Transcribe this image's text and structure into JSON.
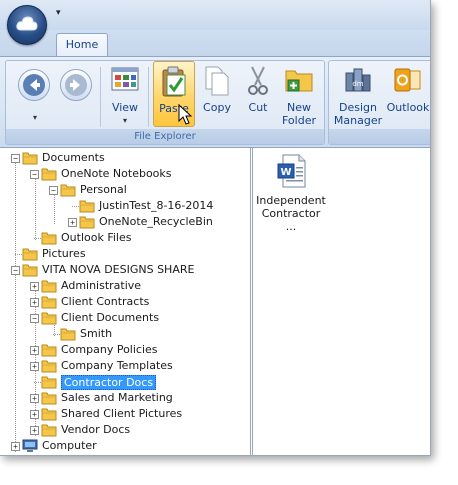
{
  "app": {
    "qat_arrow": "▾"
  },
  "tabs": [
    {
      "label": "Home"
    }
  ],
  "ribbon": {
    "groups": [
      {
        "label": "File Explorer",
        "buttons": [
          {
            "label": "View"
          },
          {
            "label": "Paste"
          },
          {
            "label": "Copy"
          },
          {
            "label": "Cut"
          },
          {
            "label_line1": "New",
            "label_line2": "Folder"
          }
        ]
      },
      {
        "label": "",
        "buttons": [
          {
            "label_line1": "Design",
            "label_line2": "Manager"
          },
          {
            "label": "Outlook"
          }
        ]
      }
    ]
  },
  "tree": [
    {
      "label": "Documents",
      "expander": "−"
    },
    {
      "label": "OneNote Notebooks",
      "expander": "−"
    },
    {
      "label": "Personal",
      "expander": "−"
    },
    {
      "label": "JustinTest_8-16-2014",
      "expander": ""
    },
    {
      "label": "OneNote_RecycleBin",
      "expander": "+"
    },
    {
      "label": "Outlook Files",
      "expander": ""
    },
    {
      "label": "Pictures",
      "expander": ""
    },
    {
      "label": "VITA NOVA DESIGNS SHARE",
      "expander": "−"
    },
    {
      "label": "Administrative",
      "expander": "+"
    },
    {
      "label": "Client Contracts",
      "expander": "+"
    },
    {
      "label": "Client Documents",
      "expander": "−"
    },
    {
      "label": "Smith",
      "expander": ""
    },
    {
      "label": "Company Policies",
      "expander": "+"
    },
    {
      "label": "Company Templates",
      "expander": "+"
    },
    {
      "label": "Contractor Docs",
      "expander": "",
      "selected": true
    },
    {
      "label": "Sales and Marketing",
      "expander": "+"
    },
    {
      "label": "Shared Client Pictures",
      "expander": "+"
    },
    {
      "label": "Vendor Docs",
      "expander": "+"
    },
    {
      "label": "Computer",
      "expander": "+"
    }
  ],
  "files": [
    {
      "label_line1": "Independent",
      "label_line2": "Contractor ..."
    }
  ],
  "colors": {
    "ribbon_text": "#15428b",
    "selection": "#3399ff",
    "folder": "#f4c64a"
  }
}
